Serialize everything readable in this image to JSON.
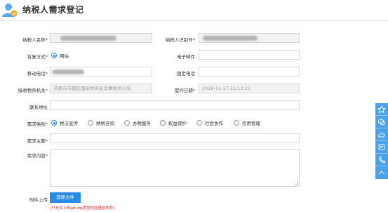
{
  "header": {
    "title": "纳税人需求登记"
  },
  "form": {
    "taxpayer_name": {
      "label": "纳税人名称",
      "required_mark": "*"
    },
    "taxpayer_id": {
      "label": "纳税人识别号",
      "required_mark": "*"
    },
    "reply_method": {
      "label": "答复方式",
      "required_mark": "*",
      "options": [
        "网站"
      ],
      "selected": "网站"
    },
    "email": {
      "label": "电子邮件"
    },
    "mobile": {
      "label": "移动电话",
      "required_mark": "*"
    },
    "landline": {
      "label": "固定电话"
    },
    "tax_office": {
      "label": "接收税务机关",
      "required_mark": "*",
      "value": "济南市市辖区国家税务局华事税务分局"
    },
    "submit_date": {
      "label": "提问日期",
      "required_mark": "*",
      "value": "2018-11-17 21:13:25"
    },
    "address": {
      "label": "联系地址"
    },
    "category": {
      "label": "需求类别",
      "required_mark": "*",
      "options": [
        "税法宣传",
        "纳税咨询",
        "办税服务",
        "权益保护",
        "社会协作",
        "信用管理"
      ],
      "selected": "税法宣传"
    },
    "subject": {
      "label": "需求主题",
      "required_mark": "*"
    },
    "content": {
      "label": "需求内容",
      "required_mark": "*"
    },
    "attachment": {
      "label": "附件上传",
      "button_label": "选择文件",
      "hint": "(只允许上传jar,zip类型的压缩包附件)"
    }
  },
  "sidebar": {
    "items": [
      "star-icon",
      "chat-icon",
      "cloud-icon",
      "message-icon",
      "phone-icon",
      "chevron-up-icon"
    ]
  },
  "colors": {
    "accent": "#2a8ae6",
    "required": "#e02020",
    "sidebar": "#4aa3ea"
  }
}
